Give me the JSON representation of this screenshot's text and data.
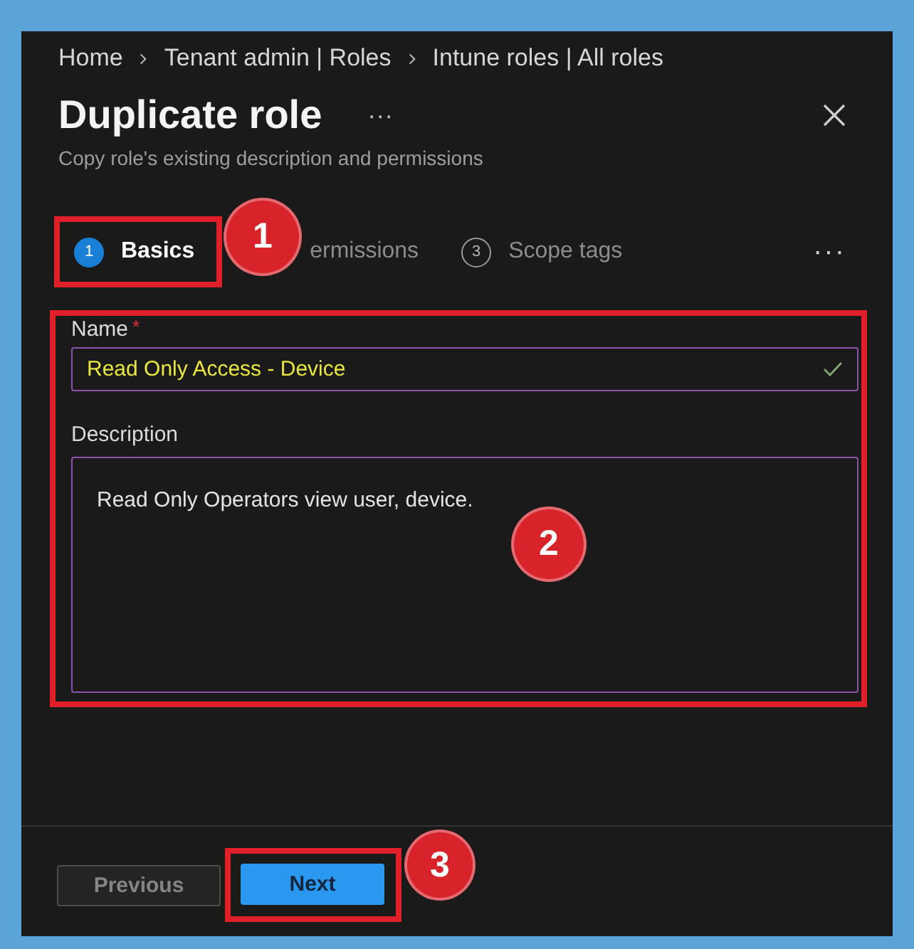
{
  "breadcrumb": [
    {
      "label": "Home"
    },
    {
      "label": "Tenant admin | Roles"
    },
    {
      "label": "Intune roles | All roles"
    }
  ],
  "header": {
    "title": "Duplicate role",
    "more": "···",
    "subtitle": "Copy role's existing description and permissions"
  },
  "steps": [
    {
      "number": "1",
      "label": "Basics",
      "selected": true,
      "highlighted": true
    },
    {
      "label": "ermissions",
      "selected": false,
      "highlighted": false
    },
    {
      "number": "3",
      "label": "Scope tags",
      "selected": false,
      "highlighted": false
    }
  ],
  "steps_more": "···",
  "form": {
    "highlighted": true,
    "name": {
      "label": "Name",
      "required_mark": "*",
      "value": "Read Only Access - Device",
      "valid": true
    },
    "description": {
      "label": "Description",
      "value": "Read Only Operators view user, device."
    }
  },
  "buttons": [
    {
      "label": "Previous",
      "kind": "secondary",
      "disabled": true,
      "highlighted": false
    },
    {
      "label": "Next",
      "kind": "primary",
      "disabled": false,
      "highlighted": true
    }
  ],
  "callouts": [
    {
      "number": "1"
    },
    {
      "number": "2"
    },
    {
      "number": "3"
    }
  ]
}
